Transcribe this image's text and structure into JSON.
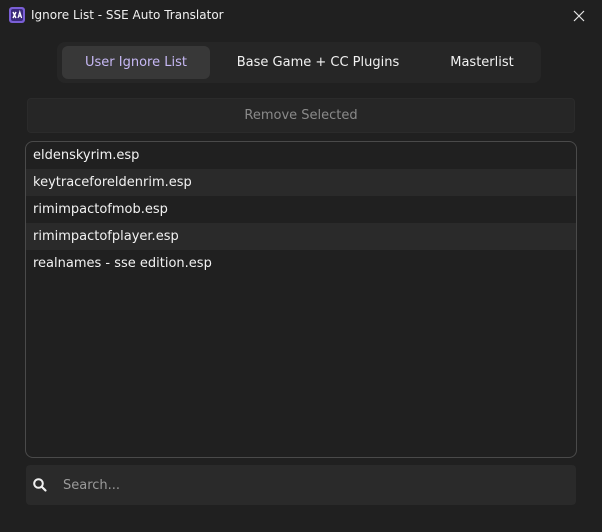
{
  "window": {
    "title": "Ignore List - SSE Auto Translator",
    "app_icon": "xa-logo-icon",
    "close_icon": "close-icon"
  },
  "tabs": [
    {
      "label": "User Ignore List",
      "active": true
    },
    {
      "label": "Base Game + CC Plugins",
      "active": false
    },
    {
      "label": "Masterlist",
      "active": false
    }
  ],
  "actions": {
    "remove_selected_label": "Remove Selected",
    "remove_selected_enabled": false
  },
  "ignore_list": {
    "items": [
      "eldenskyrim.esp",
      "keytraceforeldenrim.esp",
      "rimimpactofmob.esp",
      "rimimpactofplayer.esp",
      "realnames - sse edition.esp"
    ]
  },
  "search": {
    "placeholder": "Search...",
    "value": "",
    "icon": "search-icon"
  },
  "colors": {
    "background": "#202020",
    "accent": "#c6b8f4",
    "panel": "#262626"
  }
}
